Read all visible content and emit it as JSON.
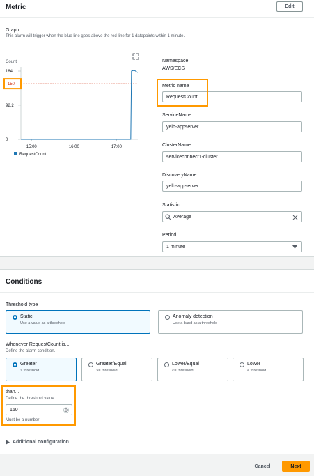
{
  "metric": {
    "title": "Metric",
    "edit_label": "Edit",
    "graph_title": "Graph",
    "graph_desc": "This alarm will trigger when the blue line goes above the red line for 1 datapoints within 1 minute.",
    "namespace_label": "Namespace",
    "namespace_value": "AWS/ECS",
    "metric_name_label": "Metric name",
    "metric_name_value": "RequestCount",
    "service_label": "ServiceName",
    "service_value": "yelb-appserver",
    "cluster_label": "ClusterName",
    "cluster_value": "serviceconnect1-cluster",
    "discovery_label": "DiscoveryName",
    "discovery_value": "yelb-appserver",
    "statistic_label": "Statistic",
    "statistic_value": "Average",
    "period_label": "Period",
    "period_value": "1 minute"
  },
  "chart_data": {
    "type": "line",
    "ylabel": "Count",
    "yticks": [
      "184",
      "92.2",
      "0"
    ],
    "ylim": [
      0,
      184
    ],
    "xticks": [
      "15:00",
      "16:00",
      "17:00"
    ],
    "threshold": 150,
    "threshold_label": "150",
    "series": [
      {
        "name": "RequestCount",
        "color": "#1f77b4",
        "x": [
          "14:45",
          "15:00",
          "15:30",
          "16:00",
          "16:30",
          "17:00",
          "17:15",
          "17:20",
          "17:21",
          "17:25",
          "17:30"
        ],
        "values": [
          0,
          0,
          0,
          0,
          0,
          0,
          0,
          0,
          184,
          186,
          180
        ]
      }
    ],
    "threshold_color": "#d13212"
  },
  "conditions": {
    "title": "Conditions",
    "threshold_type_label": "Threshold type",
    "static_title": "Static",
    "static_desc": "Use a value as a threshold",
    "anomaly_title": "Anomaly detection",
    "anomaly_desc": "Use a band as a threshold",
    "whenever_label": "Whenever RequestCount is...",
    "whenever_desc": "Define the alarm condition.",
    "options": [
      {
        "title": "Greater",
        "desc": "> threshold"
      },
      {
        "title": "Greater/Equal",
        "desc": ">= threshold"
      },
      {
        "title": "Lower/Equal",
        "desc": "<= threshold"
      },
      {
        "title": "Lower",
        "desc": "< threshold"
      }
    ],
    "than_label": "than...",
    "than_desc": "Define the threshold value.",
    "threshold_value": "150",
    "must_be_number": "Must be a number",
    "additional_config": "Additional configuration"
  },
  "footer": {
    "cancel_label": "Cancel",
    "next_label": "Next"
  },
  "colors": {
    "accent": "#0073bb",
    "highlight": "#ff9900",
    "primary_button": "#ff9900"
  }
}
